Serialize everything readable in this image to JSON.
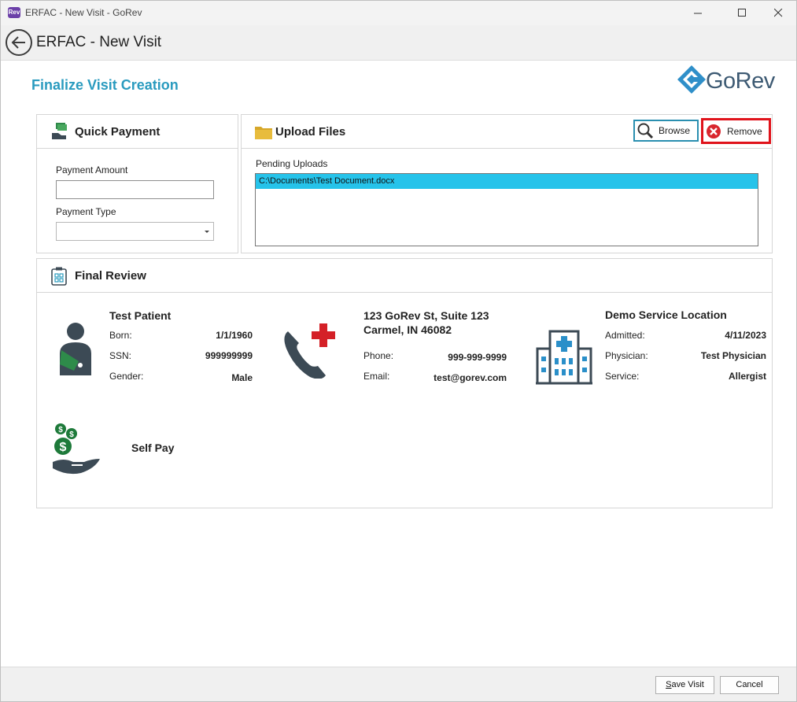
{
  "window": {
    "title": "ERFAC - New Visit - GoRev",
    "app_icon_text": "Rev"
  },
  "header": {
    "title": "ERFAC - New Visit"
  },
  "page": {
    "title": "Finalize Visit Creation",
    "logo_text": "GoRev"
  },
  "quick_payment": {
    "title": "Quick Payment",
    "amount_label": "Payment Amount",
    "amount_value": "",
    "type_label": "Payment Type",
    "type_value": ""
  },
  "upload_files": {
    "title": "Upload Files",
    "browse_label": "Browse",
    "remove_label": "Remove",
    "pending_label": "Pending Uploads",
    "items": [
      "C:\\Documents\\Test Document.docx"
    ]
  },
  "final_review": {
    "title": "Final Review",
    "patient": {
      "name": "Test Patient",
      "born_label": "Born:",
      "born": "1/1/1960",
      "ssn_label": "SSN:",
      "ssn": "999999999",
      "gender_label": "Gender:",
      "gender": "Male"
    },
    "contact": {
      "address_line1": "123 GoRev St, Suite 123",
      "address_line2": "Carmel, IN 46082",
      "phone_label": "Phone:",
      "phone": "999-999-9999",
      "email_label": "Email:",
      "email": "test@gorev.com"
    },
    "location": {
      "name": "Demo Service Location",
      "admitted_label": "Admitted:",
      "admitted": "4/11/2023",
      "physician_label": "Physician:",
      "physician": "Test Physician",
      "service_label": "Service:",
      "service": "Allergist"
    },
    "payer": {
      "name": "Self Pay"
    }
  },
  "footer": {
    "save_label": "ave Visit",
    "save_mnemonic": "S",
    "cancel_label": "Cancel"
  },
  "colors": {
    "accent": "#2a9bbf",
    "selection": "#26c3ea",
    "remove_border": "#e0131b",
    "icon_dark": "#3c4a55",
    "icon_green": "#1e7a3a",
    "cross_red": "#d42027"
  }
}
